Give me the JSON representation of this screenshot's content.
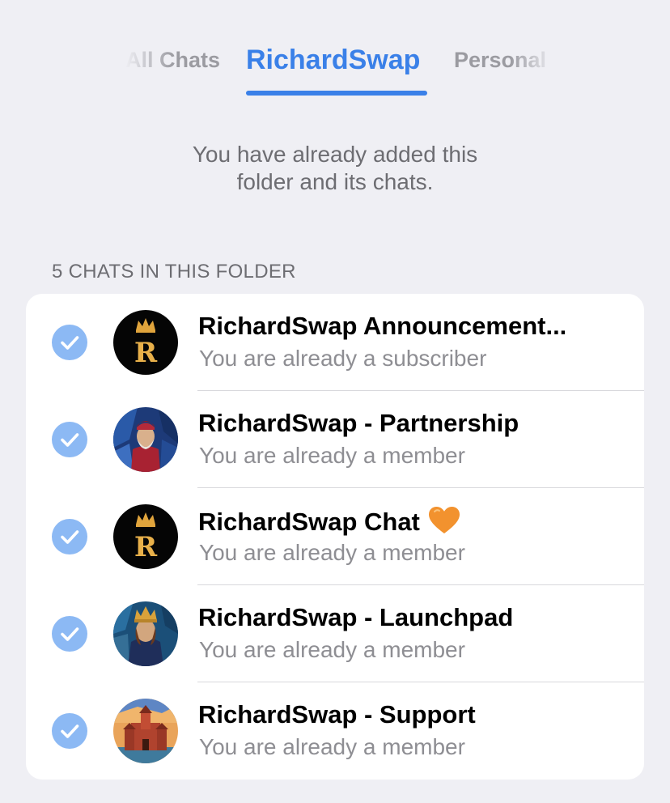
{
  "tabs": {
    "left_label": "All Chats",
    "active_label": "RichardSwap",
    "right_label": "Personal"
  },
  "info": {
    "line1": "You have already added this",
    "line2": "folder and its chats."
  },
  "section": {
    "header": "5 CHATS IN THIS FOLDER"
  },
  "chats": [
    {
      "title": "RichardSwap Announcement...",
      "subtitle": "You are already a subscriber",
      "avatar": "crown-r-logo",
      "checked": true
    },
    {
      "title": "RichardSwap - Partnership",
      "subtitle": "You are already a member",
      "avatar": "stained-glass-bishop",
      "checked": true
    },
    {
      "title": "RichardSwap Chat",
      "title_emoji": "orange-heart-icon",
      "subtitle": "You are already a member",
      "avatar": "crown-r-logo",
      "checked": true
    },
    {
      "title": "RichardSwap - Launchpad",
      "subtitle": "You are already a member",
      "avatar": "stained-glass-king",
      "checked": true
    },
    {
      "title": "RichardSwap - Support",
      "subtitle": "You are already a member",
      "avatar": "stained-glass-castle",
      "checked": true
    }
  ],
  "colors": {
    "background": "#efeff4",
    "accent": "#3a80e8",
    "check": "#8cb9f4",
    "secondary_text": "#8e8e93",
    "heart": "#f2922e"
  }
}
